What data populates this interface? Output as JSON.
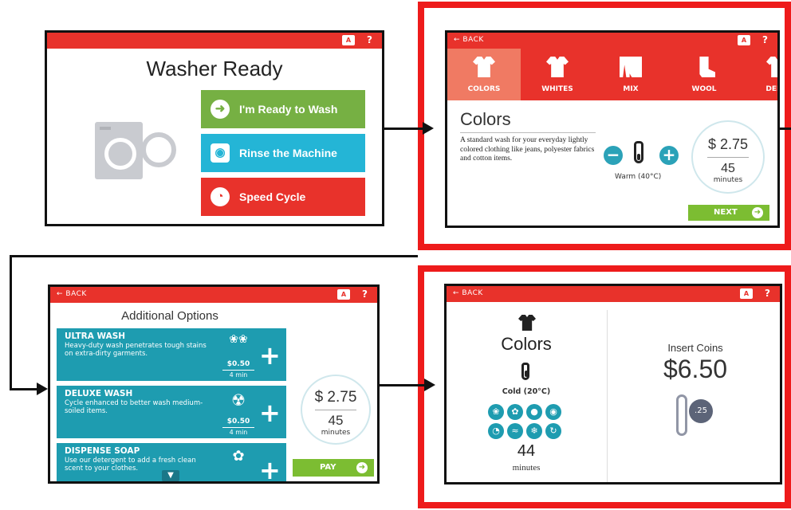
{
  "common": {
    "back_label": "BACK",
    "lang_label": "A",
    "help_label": "?"
  },
  "colors": {
    "header_red": "#e8322b",
    "highlight_red": "#ee1b1b",
    "teal": "#1e9cb0",
    "green": "#7cbd32",
    "sky_blue": "#24b5d6"
  },
  "screen1": {
    "title": "Washer Ready",
    "buttons": [
      {
        "label": "I'm Ready to Wash",
        "icon": "arrow-right-icon",
        "color": "#76b043"
      },
      {
        "label": "Rinse the Machine",
        "icon": "washer-icon",
        "color": "#24b5d6"
      },
      {
        "label": "Speed Cycle",
        "icon": "timer-icon",
        "color": "#e8322b"
      }
    ]
  },
  "screen2": {
    "tabs": [
      {
        "label": "COLORS",
        "icon": "tshirt-icon"
      },
      {
        "label": "WHITES",
        "icon": "tshirt-icon"
      },
      {
        "label": "MIX",
        "icon": "mixed-clothes-icon"
      },
      {
        "label": "WOOL",
        "icon": "sock-icon"
      },
      {
        "label": "DELIC",
        "icon": "dress-icon"
      }
    ],
    "title": "Colors",
    "description": "A standard wash for your everyday lightly colored clothing like jeans, polyester fabrics and cotton items.",
    "temperature": "Warm (40°C)",
    "price": "$ 2.75",
    "minutes": "45",
    "minutes_unit": "minutes",
    "next_label": "NEXT"
  },
  "screen3": {
    "title": "Additional Options",
    "options": [
      {
        "name": "ULTRA WASH",
        "desc": "Heavy-duty wash penetrates tough stains on extra-dirty garments.",
        "price": "$0.50",
        "time": "4 min"
      },
      {
        "name": "DELUXE WASH",
        "desc": "Cycle enhanced to better wash medium-soiled items.",
        "price": "$0.50",
        "time": "4 min"
      },
      {
        "name": "DISPENSE SOAP",
        "desc": "Use our detergent to add a fresh clean scent to your clothes.",
        "price": "",
        "time": ""
      }
    ],
    "price": "$ 2.75",
    "minutes": "45",
    "minutes_unit": "minutes",
    "pay_label": "PAY"
  },
  "screen4": {
    "title": "Colors",
    "temperature": "Cold (20°C)",
    "minutes": "44",
    "minutes_unit": "minutes",
    "insert_label": "Insert Coins",
    "amount": "$6.50",
    "coin_label": ".25"
  }
}
